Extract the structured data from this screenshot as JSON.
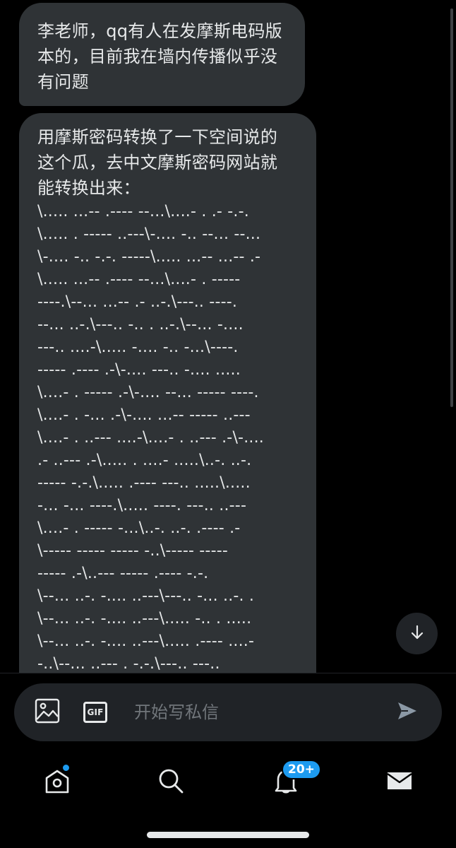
{
  "messages": [
    {
      "lines": [
        "李老师，qq有人在发摩斯电码版",
        "本的，目前我在墙内传播似乎没",
        "有问题"
      ]
    },
    {
      "intro_lines": [
        "用摩斯密码转换了一下空间说的",
        "这个瓜，去中文摩斯密码网站就",
        "能转换出来："
      ],
      "morse_lines": [
        "\\..... ...-- .---- --...\\....- . .- -.-.",
        "\\..... . ----- ..---\\-.... -.. --... --...",
        "\\-.... -.. -.-. -----\\..... ...-- ...-- .-",
        "\\..... ...-- .---- --...\\....- . -----",
        "----.\\--... ...-- .- ..-.\\---.. ----.",
        "--... ..-.\\---.. -.. . ..-.\\--... -....",
        "---.. ....-\\..... -.... -.. -...\\----.",
        "----- .---- .-\\-.... ---.. -.... .....",
        "\\....- . ----- .-\\-.... --... ----- ----.",
        "\\....- . -... .-\\-.... ...-- ----- ..---",
        "\\....- . ..--- ....-\\....- . ..--- .-\\-....",
        ".- ..--- .-\\..... . ....- .....\\..-. ..-.",
        "----- -.-.\\..... .---- ---.. .....\\.....",
        "-... -... ----.\\..... ----. ---.. ..---",
        "\\....- . ----- -...\\..-. ..-. .---- .-",
        "\\----- ----- ----- -..\\----- -----",
        "----- .-\\..--- ----- .---- -.-.",
        "\\--... ..-. -.... ..---\\---.. -... ..-. .",
        "\\--... ..-. -.... ..---\\..... -.. . .....",
        "\\--... ..-. -.... ..---\\..... .---- ....-",
        "-..\\--... ..--- . -.-.\\---.. ---.."
      ]
    }
  ],
  "icons": {
    "scroll_down": "arrow-down-icon",
    "image": "image-icon",
    "gif": "gif-icon",
    "send": "send-icon",
    "home": "home-icon",
    "search": "search-icon",
    "notifications": "bell-icon",
    "messages": "mail-icon"
  },
  "composer": {
    "gif_label": "GIF",
    "placeholder": "开始写私信"
  },
  "tabbar": {
    "notifications_badge": "20+"
  },
  "colors": {
    "background": "#000000",
    "bubble": "#2f3336",
    "text": "#e7e9ea",
    "muted": "#71767b",
    "accent": "#1d9bf0"
  }
}
